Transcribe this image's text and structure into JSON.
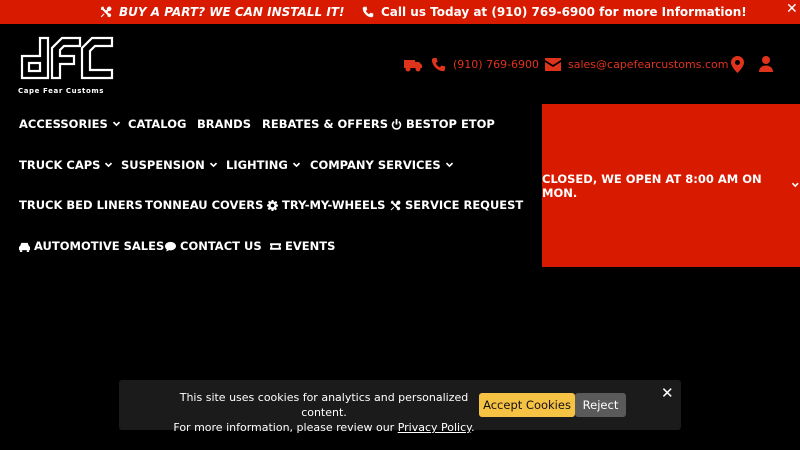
{
  "topbar": {
    "promo_icon": "tools-icon",
    "promo_text": "BUY A PART? WE CAN INSTALL IT!",
    "call_icon": "phone-icon",
    "call_text": "Call us Today at (910) 769-6900 for more Information!",
    "close_label": "✕"
  },
  "logo": {
    "letters": "dfc",
    "tagline": "Cape Fear Customs"
  },
  "contact": {
    "phone": "(910) 769-6900",
    "email": "sales@capefearcustoms.com",
    "accent": "#e0331c"
  },
  "nav": {
    "accessories": "ACCESSORIES",
    "catalog": "CATALOG",
    "brands": "BRANDS",
    "rebates": "REBATES & OFFERS",
    "bestop": "BESTOP ETOP",
    "truck_caps": "TRUCK CAPS",
    "suspension": "SUSPENSION",
    "lighting": "LIGHTING",
    "company_services": "COMPANY SERVICES",
    "bed_liners": "TRUCK BED LINERS",
    "tonneau": "TONNEAU COVERS",
    "try_wheels": "TRY-MY-WHEELS",
    "service_request": "SERVICE REQUEST",
    "auto_sales": "AUTOMOTIVE SALES",
    "contact_us": "CONTACT US",
    "events": "EVENTS"
  },
  "hours": {
    "text": "CLOSED, WE OPEN AT 8:00 AM ON MON.",
    "bg": "#d71a00"
  },
  "cookie": {
    "line1": "This site uses cookies for analytics and personalized content.",
    "line2_prefix": "For more information, please review our ",
    "policy_link": "Privacy Policy",
    "line2_suffix": ".",
    "accept": "Accept Cookies",
    "reject": "Reject",
    "close": "✕",
    "accept_color": "#f6c244"
  }
}
